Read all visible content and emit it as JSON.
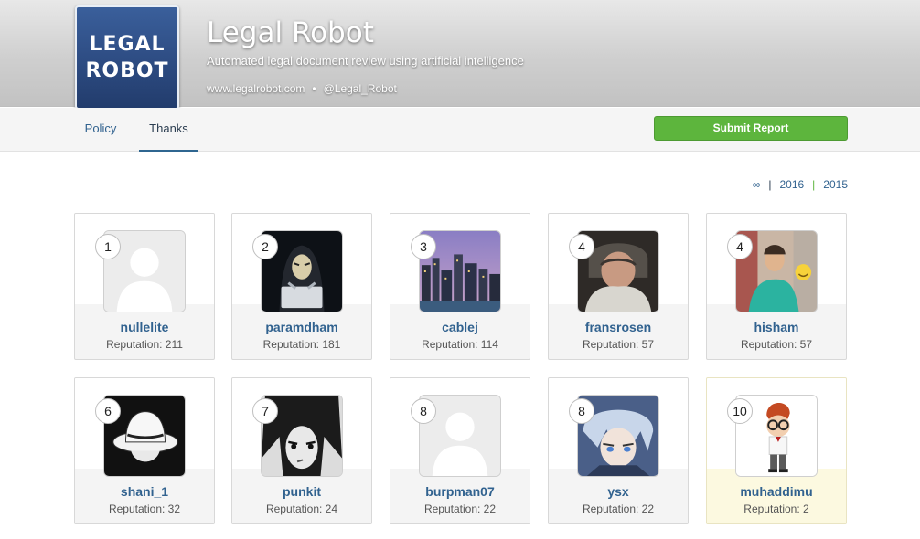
{
  "program": {
    "logo_line1": "LEGAL",
    "logo_line2": "ROBOT",
    "title": "Legal Robot",
    "description": "Automated legal document review using artificial intelligence",
    "website": "www.legalrobot.com",
    "separator": "•",
    "twitter": "@Legal_Robot"
  },
  "nav": {
    "tabs": [
      {
        "label": "Policy"
      },
      {
        "label": "Thanks"
      }
    ],
    "submit_label": "Submit Report"
  },
  "filters": {
    "all_label": "∞",
    "years": [
      "2016",
      "2015"
    ]
  },
  "hackers": [
    {
      "rank": "1",
      "username": "nullelite",
      "reputation": "Reputation: 211",
      "avatar": "default-avatar"
    },
    {
      "rank": "2",
      "username": "paramdham",
      "reputation": "Reputation: 181",
      "avatar": "hooded-hacker-avatar"
    },
    {
      "rank": "3",
      "username": "cablej",
      "reputation": "Reputation: 114",
      "avatar": "city-skyline-avatar"
    },
    {
      "rank": "4",
      "username": "fransrosen",
      "reputation": "Reputation: 57",
      "avatar": "photo-avatar"
    },
    {
      "rank": "4",
      "username": "hisham",
      "reputation": "Reputation: 57",
      "avatar": "photo-avatar"
    },
    {
      "rank": "6",
      "username": "shani_1",
      "reputation": "Reputation: 32",
      "avatar": "white-hat-avatar"
    },
    {
      "rank": "7",
      "username": "punkit",
      "reputation": "Reputation: 24",
      "avatar": "anime-avatar"
    },
    {
      "rank": "8",
      "username": "burpman07",
      "reputation": "Reputation: 22",
      "avatar": "default-avatar"
    },
    {
      "rank": "8",
      "username": "ysx",
      "reputation": "Reputation: 22",
      "avatar": "anime-avatar"
    },
    {
      "rank": "10",
      "username": "muhaddimu",
      "reputation": "Reputation: 2",
      "avatar": "cartoon-avatar"
    }
  ]
}
